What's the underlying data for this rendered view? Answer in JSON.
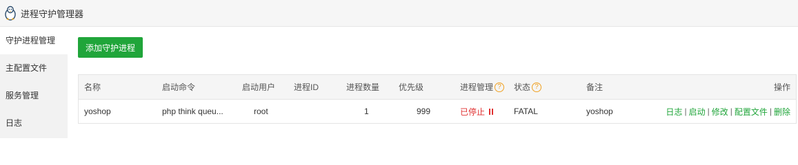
{
  "window": {
    "title": "进程守护管理器",
    "logo_icon": "penguin-icon"
  },
  "sidebar": {
    "items": [
      {
        "label": "守护进程管理",
        "active": true
      },
      {
        "label": "主配置文件",
        "active": false
      },
      {
        "label": "服务管理",
        "active": false
      },
      {
        "label": "日志",
        "active": false
      }
    ]
  },
  "toolbar": {
    "add_label": "添加守护进程"
  },
  "table": {
    "headers": {
      "name": "名称",
      "command": "启动命令",
      "user": "启动用户",
      "pid": "进程ID",
      "count": "进程数量",
      "priority": "优先级",
      "manage": "进程管理",
      "status": "状态",
      "remark": "备注",
      "actions": "操作"
    },
    "help_icon": "?",
    "rows": [
      {
        "name": "yoshop",
        "command": "php think queu...",
        "user": "root",
        "pid": "",
        "count": "1",
        "priority": "999",
        "manage": "已停止",
        "status": "FATAL",
        "remark": "yoshop",
        "actions": {
          "log": "日志",
          "start": "启动",
          "edit": "修改",
          "config": "配置文件",
          "delete": "删除",
          "sep": "|"
        }
      }
    ]
  },
  "colors": {
    "accent": "#20a53a",
    "stopped": "#e03030",
    "help": "#f0a020"
  }
}
